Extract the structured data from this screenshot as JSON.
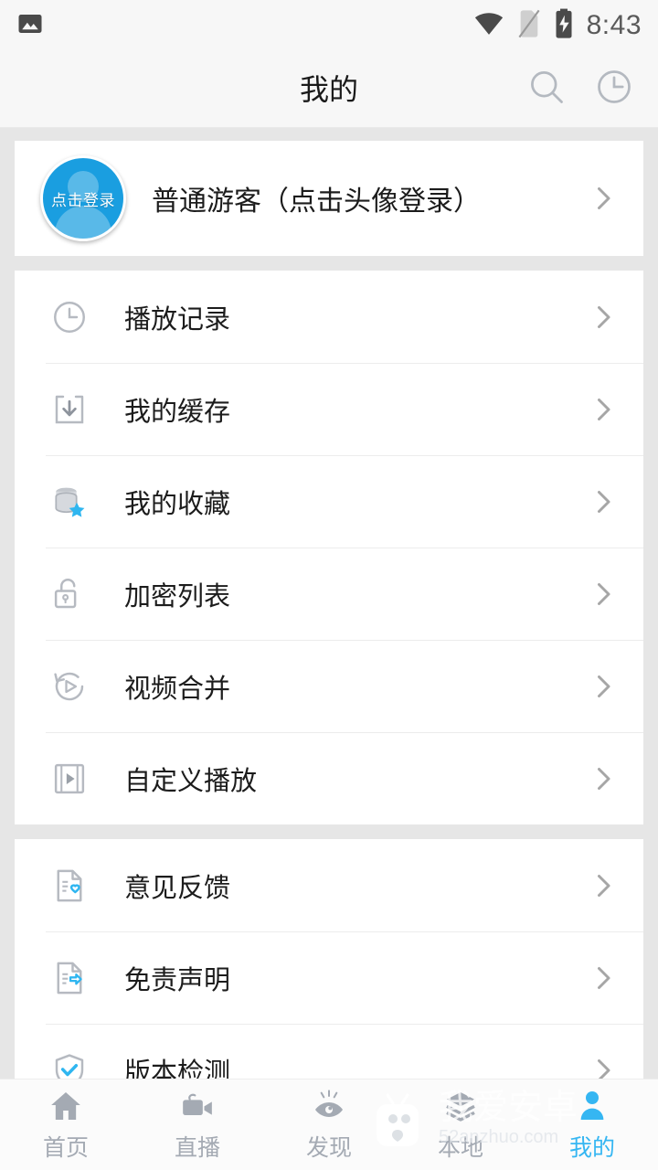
{
  "statusbar": {
    "left_icon": "image-icon",
    "wifi_icon": "wifi-icon",
    "sim_icon": "no-sim-icon",
    "battery_icon": "battery-charging-icon",
    "time": "8:43"
  },
  "header": {
    "title": "我的",
    "actions": [
      {
        "name": "search-icon"
      },
      {
        "name": "history-clock-icon"
      }
    ]
  },
  "profile": {
    "avatar_text": "点击登录",
    "name": "普通游客（点击头像登录）",
    "chevron": "›"
  },
  "sections": [
    {
      "name": "media-section",
      "items": [
        {
          "icon": "clock-icon",
          "label": "播放记录"
        },
        {
          "icon": "download-icon",
          "label": "我的缓存"
        },
        {
          "icon": "database-star-icon",
          "label": "我的收藏"
        },
        {
          "icon": "unlock-icon",
          "label": "加密列表"
        },
        {
          "icon": "video-merge-icon",
          "label": "视频合并"
        },
        {
          "icon": "film-play-icon",
          "label": "自定义播放"
        }
      ]
    },
    {
      "name": "about-section",
      "items": [
        {
          "icon": "doc-heart-icon",
          "label": "意见反馈"
        },
        {
          "icon": "doc-arrow-icon",
          "label": "免责声明"
        },
        {
          "icon": "shield-check-icon",
          "label": "版本检测"
        }
      ]
    }
  ],
  "tabbar": {
    "items": [
      {
        "icon": "home-icon",
        "label": "首页",
        "active": false
      },
      {
        "icon": "camera-icon",
        "label": "直播",
        "active": false
      },
      {
        "icon": "eye-icon",
        "label": "发现",
        "active": false
      },
      {
        "icon": "layers-icon",
        "label": "本地",
        "active": false
      },
      {
        "icon": "person-icon",
        "label": "我的",
        "active": true
      }
    ]
  },
  "watermark": {
    "title": "我爱安卓",
    "url": "52anzhuo.com"
  },
  "colors": {
    "accent": "#35b6f2",
    "avatar_blue": "#1a9ee0",
    "page_bg": "#e6e6e6",
    "card_bg": "#ffffff",
    "header_bg": "#f7f7f7",
    "icon_gray": "#b0b4ba",
    "tab_inactive": "#a4aab3"
  }
}
